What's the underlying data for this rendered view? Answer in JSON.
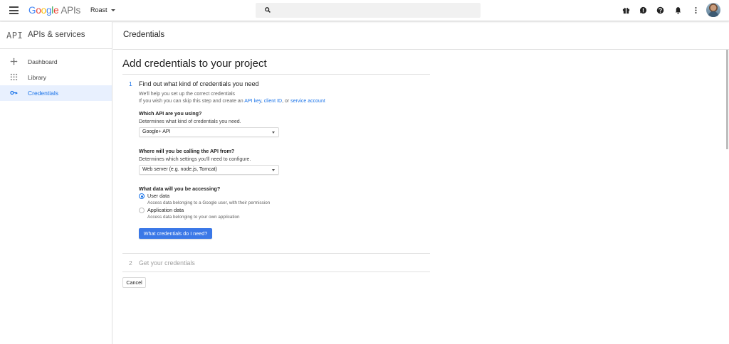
{
  "topbar": {
    "logo_letters": [
      "G",
      "o",
      "o",
      "g",
      "l",
      "e"
    ],
    "logo_suffix": "APIs",
    "project": "Roast",
    "icons": [
      "menu-icon",
      "search-icon",
      "gift-icon",
      "feedback-icon",
      "help-icon",
      "notifications-icon",
      "more-vert-icon"
    ]
  },
  "sidebar": {
    "badge": "API",
    "title": "APIs & services",
    "items": [
      {
        "label": "Dashboard",
        "icon": "dashboard-icon"
      },
      {
        "label": "Library",
        "icon": "library-icon"
      },
      {
        "label": "Credentials",
        "icon": "key-icon",
        "active": true
      }
    ]
  },
  "page": {
    "title": "Credentials"
  },
  "main": {
    "heading": "Add credentials to your project",
    "step1": {
      "number": "1",
      "title": "Find out what kind of credentials you need",
      "help_line1": "We'll help you set up the correct credentials",
      "help_line2_prefix": "If you wish you can skip this step and create an",
      "link_api_key": "API key",
      "sep1": ",",
      "link_client_id": "client ID",
      "sep2": ", or",
      "link_service_account": "service account"
    },
    "q1": {
      "label": "Which API are you using?",
      "hint": "Determines what kind of credentials you need.",
      "value": "Google+ API"
    },
    "q2": {
      "label": "Where will you be calling the API from?",
      "hint": "Determines which settings you'll need to configure.",
      "value": "Web server (e.g. node.js, Tomcat)"
    },
    "q3": {
      "label": "What data will you be accessing?",
      "options": [
        {
          "label": "User data",
          "desc": "Access data belonging to a Google user, with their permission",
          "selected": true
        },
        {
          "label": "Application data",
          "desc": "Access data belonging to your own application",
          "selected": false
        }
      ]
    },
    "submit_label": "What credentials do I need?",
    "step2": {
      "number": "2",
      "title": "Get your credentials"
    },
    "cancel_label": "Cancel"
  },
  "colors": {
    "accent": "#1a73e8",
    "primary_button": "#3b78e7",
    "active_nav_bg": "#e8f0fe"
  }
}
